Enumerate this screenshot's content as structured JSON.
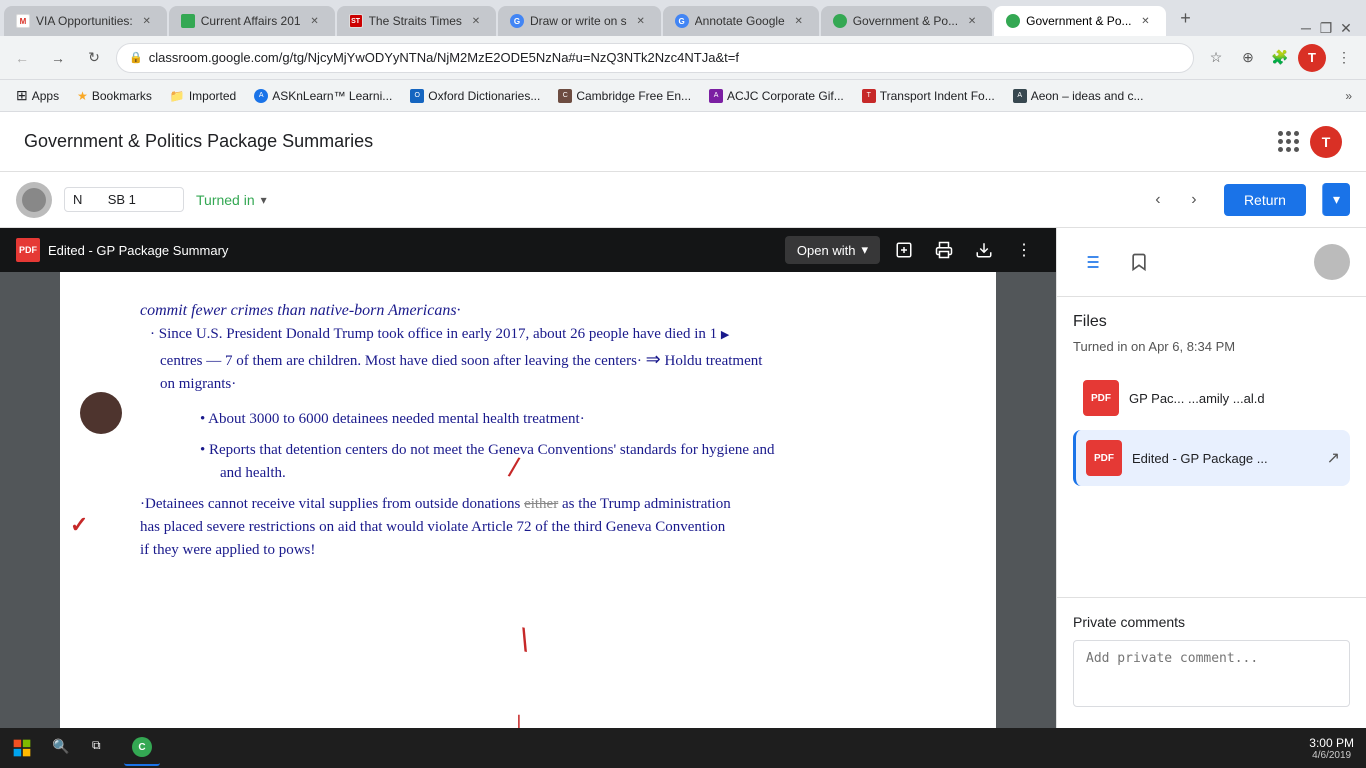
{
  "browser": {
    "tabs": [
      {
        "id": "tab1",
        "label": "VIA Opportunities:",
        "favicon_type": "gmail",
        "active": false
      },
      {
        "id": "tab2",
        "label": "Current Affairs 201",
        "favicon_type": "classroom",
        "active": false
      },
      {
        "id": "tab3",
        "label": "The Straits Times",
        "favicon_type": "straits",
        "active": false
      },
      {
        "id": "tab4",
        "label": "Draw or write on s",
        "favicon_type": "google",
        "active": false
      },
      {
        "id": "tab5",
        "label": "Annotate Google",
        "favicon_type": "annotate",
        "active": false
      },
      {
        "id": "tab6",
        "label": "Government & Po...",
        "favicon_type": "gov",
        "active": false
      },
      {
        "id": "tab7",
        "label": "Government & Po...",
        "favicon_type": "gov",
        "active": true
      }
    ],
    "address_bar": {
      "url": "classroom.google.com/g/tg/NjcyMjYwODYyNTNa/NjM2MzE2ODE5NzNa#u=NzQ3NTk2Nzc4NTJa&t=f",
      "secure": true
    },
    "bookmarks": [
      {
        "label": "Apps",
        "type": "apps"
      },
      {
        "label": "Bookmarks",
        "type": "star"
      },
      {
        "label": "Imported",
        "type": "folder"
      },
      {
        "label": "ASKnLearn™ Learni...",
        "type": "favicon"
      },
      {
        "label": "Oxford Dictionaries...",
        "type": "favicon"
      },
      {
        "label": "Cambridge Free En...",
        "type": "favicon"
      },
      {
        "label": "ACJC Corporate Gif...",
        "type": "favicon"
      },
      {
        "label": "Transport Indent Fo...",
        "type": "favicon"
      },
      {
        "label": "Aeon – ideas and c...",
        "type": "favicon"
      }
    ]
  },
  "app": {
    "title": "Government & Politics Package Summaries",
    "header_icons": {
      "grid": "apps-icon",
      "avatar": "T"
    }
  },
  "assignment": {
    "student_name": "N",
    "student_grade": "SB 1",
    "status": "Turned in",
    "status_color": "#34a853",
    "return_btn": "Return"
  },
  "document": {
    "toolbar": {
      "pdf_label": "PDF",
      "title": "Edited - GP Package Summary",
      "open_with": "Open with"
    },
    "content": {
      "lines": [
        "commit fewer crimes than native-born Americans·",
        "Since U.S. President Donald Trump took office in early 2017, about 26 people have died in the",
        "centres — 7 of them are children. Most have died soon after leaving the centers.",
        "⇒ Hold treatment on migrants.",
        "About 3000 to 6000 detainees needed mental health treatment·",
        "Reports that detention centers do not meet the Geneva Conventions' standards for hygiene and",
        "and health.",
        "·Detainees cannot receive vital supplies from outside donations either as the Trump administration",
        "has placed severe restrictions on aid that would violate Article 72 of the third Geneva Convention",
        "if they were applied to pows!"
      ]
    }
  },
  "sidebar": {
    "files_title": "Files",
    "turned_in_info": "Turned in on Apr 6, 8:34 PM",
    "files": [
      {
        "name": "GP Pac... ...amily ...al.d",
        "type": "pdf",
        "active": false
      },
      {
        "name": "Edited - GP Package ...",
        "type": "pdf",
        "active": true
      }
    ],
    "private_comments": {
      "title": "Private comments",
      "placeholder": "Add private comment..."
    }
  },
  "taskbar": {
    "clock": "3:00 PM"
  }
}
